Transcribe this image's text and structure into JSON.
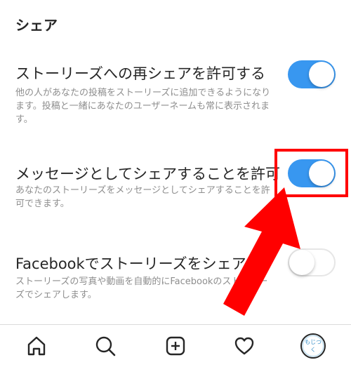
{
  "section": {
    "title": "シェア"
  },
  "settings": [
    {
      "title": "ストーリーズへの再シェアを許可する",
      "description": "他の人があなたの投稿をストーリーズに追加できるようになります。投稿と一緒にあなたのユーザーネームも常に表示されます。",
      "enabled": true
    },
    {
      "title": "メッセージとしてシェアすることを許可",
      "description": "あなたのストーリーズをメッセージとしてシェアすることを許可できます。",
      "enabled": true
    },
    {
      "title": "Facebookでストーリーズをシェア",
      "description": "ストーリーズの写真や動画を自動的にFacebookのストーリーズでシェアします。",
      "enabled": false
    }
  ],
  "annotation": {
    "highlight_color": "#ff0000",
    "arrow_color": "#ff0000"
  },
  "bottom_nav": {
    "items": [
      "home-icon",
      "search-icon",
      "add-post-icon",
      "heart-icon",
      "profile-avatar"
    ],
    "avatar_text": "もじつく"
  },
  "colors": {
    "toggle_on": "#3897f0",
    "toggle_off": "#ffffff",
    "text": "#262626",
    "subtext": "#8e8e8e"
  }
}
